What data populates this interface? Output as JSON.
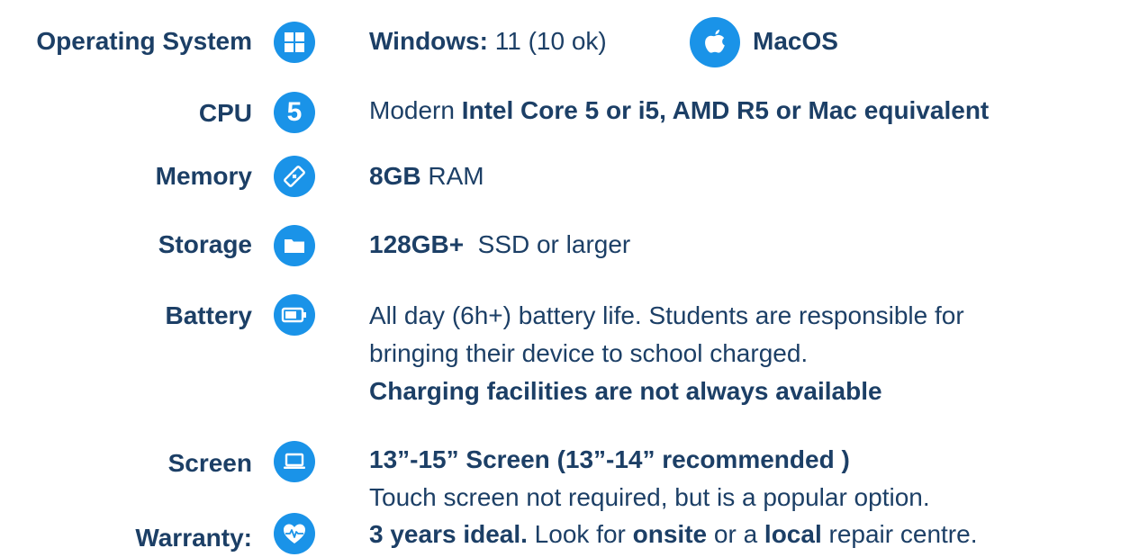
{
  "rows": {
    "os": {
      "label": "Operating System",
      "icon": "windows-icon",
      "windows_label": "Windows:",
      "windows_value": " 11 (10 ok)",
      "mac_icon": "apple-icon",
      "mac_label": "MacOS"
    },
    "cpu": {
      "label": "CPU",
      "icon": "number-five-icon",
      "icon_text": "5",
      "prefix": "Modern ",
      "bold": "Intel Core 5 or i5, AMD R5 or Mac equivalent"
    },
    "memory": {
      "label": "Memory",
      "icon": "memory-stick-icon",
      "bold": "8GB",
      "suffix": " RAM"
    },
    "storage": {
      "label": "Storage",
      "icon": "folder-icon",
      "bold": "128GB+",
      "suffix": "  SSD or larger"
    },
    "battery": {
      "label": "Battery",
      "icon": "battery-icon",
      "line1": "All day (6h+) battery life. Students are responsible for",
      "line2": "bringing their device to school charged.",
      "line3_bold": "Charging facilities are not always available"
    },
    "screen": {
      "label": "Screen",
      "icon": "laptop-icon",
      "line1_bold": "13”-15” Screen (13”-14” recommended )",
      "line2": "Touch screen not required, but is a popular option."
    },
    "warranty": {
      "label": "Warranty:",
      "icon": "heart-pulse-icon",
      "bold1": "3 years ideal.",
      "text1": " Look for ",
      "bold2": "onsite",
      "text2": " or a ",
      "bold3": "local",
      "text3": " repair centre."
    }
  }
}
